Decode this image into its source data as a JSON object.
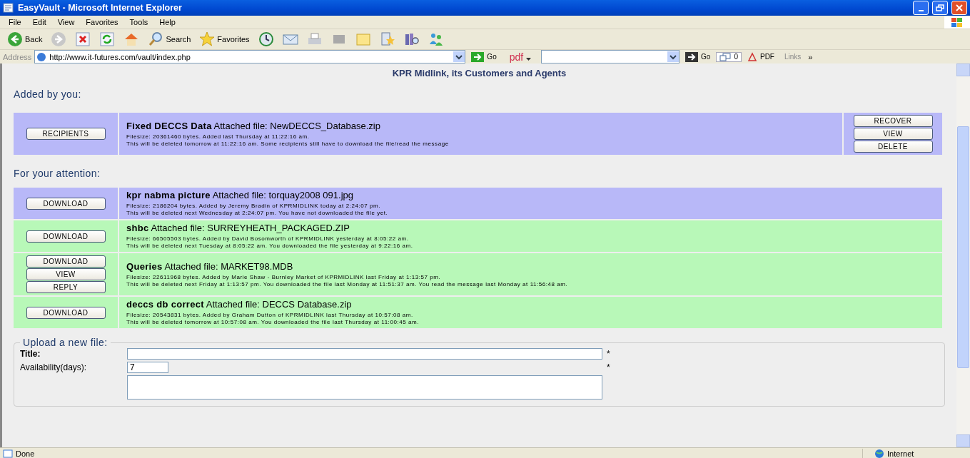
{
  "window": {
    "title": "EasyVault - Microsoft Internet Explorer"
  },
  "menu": [
    "File",
    "Edit",
    "View",
    "Favorites",
    "Tools",
    "Help"
  ],
  "toolbar": [
    {
      "kind": "back",
      "label": "Back"
    },
    {
      "kind": "forward"
    },
    {
      "kind": "stop"
    },
    {
      "kind": "refresh"
    },
    {
      "kind": "home"
    },
    {
      "kind": "search",
      "label": "Search"
    },
    {
      "kind": "favorites",
      "label": "Favorites"
    },
    {
      "kind": "history"
    },
    {
      "kind": "mail"
    },
    {
      "kind": "print"
    },
    {
      "kind": "edit"
    },
    {
      "kind": "note"
    },
    {
      "kind": "research"
    },
    {
      "kind": "library"
    },
    {
      "kind": "messenger"
    }
  ],
  "address_bar": {
    "label": "Address",
    "url": "http://www.it-futures.com/vault/index.php",
    "go": "Go",
    "pdf_menu": "pdf",
    "go2": "Go",
    "popup_count": "0",
    "pdf": "PDF",
    "links": "Links",
    "more": "»"
  },
  "page": {
    "subtitle": "KPR Midlink, its Customers and Agents",
    "added_heading": "Added by you:",
    "added": [
      {
        "color": "#b8b8f8",
        "buttons": [
          "RECIPIENTS"
        ],
        "title": "Fixed DECCS Data",
        "attachment": "Attached file: NewDECCS_Database.zip",
        "details": [
          "Filesize: 20361460 bytes. Added last Thursday at 11:22:16 am.",
          "This will be deleted tomorrow at 11:22:16 am. Some recipients still have to download the file/read the message"
        ],
        "actions": [
          "RECOVER",
          "VIEW",
          "DELETE"
        ]
      }
    ],
    "attention_heading": "For your attention:",
    "attention": [
      {
        "color": "#b8b8f8",
        "buttons": [
          "DOWNLOAD"
        ],
        "title": "kpr nabma picture",
        "attachment": "Attached file: torquay2008 091.jpg",
        "details": [
          "Filesize: 2186204 bytes. Added by Jeremy Bradin of KPRMIDLINK today at 2:24:07 pm.",
          "This will be deleted next Wednesday at 2:24:07 pm. You have not downloaded the file yet."
        ]
      },
      {
        "color": "#b8f8b8",
        "buttons": [
          "DOWNLOAD"
        ],
        "title": "shbc",
        "attachment": "Attached file: SURREYHEATH_PACKAGED.ZIP",
        "details": [
          "Filesize: 66505503 bytes. Added by David Bosomworth of KPRMIDLINK yesterday at 8:05:22 am.",
          "This will be deleted next Tuesday at 8:05:22 am. You downloaded the file yesterday at 9:22:16 am."
        ]
      },
      {
        "color": "#b8f8b8",
        "buttons": [
          "DOWNLOAD",
          "VIEW",
          "REPLY"
        ],
        "title": "Queries",
        "attachment": "Attached file: MARKET98.MDB",
        "details": [
          "Filesize: 22611968 bytes. Added by Marie Shaw - Burnley Market of KPRMIDLINK last Friday at 1:13:57 pm.",
          "This will be deleted next Friday at 1:13:57 pm. You downloaded the file last Monday at 11:51:37 am. You read the message last Monday at 11:56:48 am."
        ]
      },
      {
        "color": "#b8f8b8",
        "buttons": [
          "DOWNLOAD"
        ],
        "title": "deccs db correct",
        "attachment": "Attached file: DECCS Database.zip",
        "details": [
          "Filesize: 20543831 bytes. Added by Graham Dutton of KPRMIDLINK last Thursday at 10:57:08 am.",
          "This will be deleted tomorrow at 10:57:08 am. You downloaded the file last Thursday at 11:00:45 am."
        ]
      }
    ],
    "upload": {
      "legend": "Upload a new file:",
      "title_label": "Title:",
      "title_required": "*",
      "availability_label": "Availability(days):",
      "availability_value": "7",
      "availability_required": "*"
    }
  },
  "status_bar": {
    "text": "Done",
    "zone": "Internet"
  }
}
